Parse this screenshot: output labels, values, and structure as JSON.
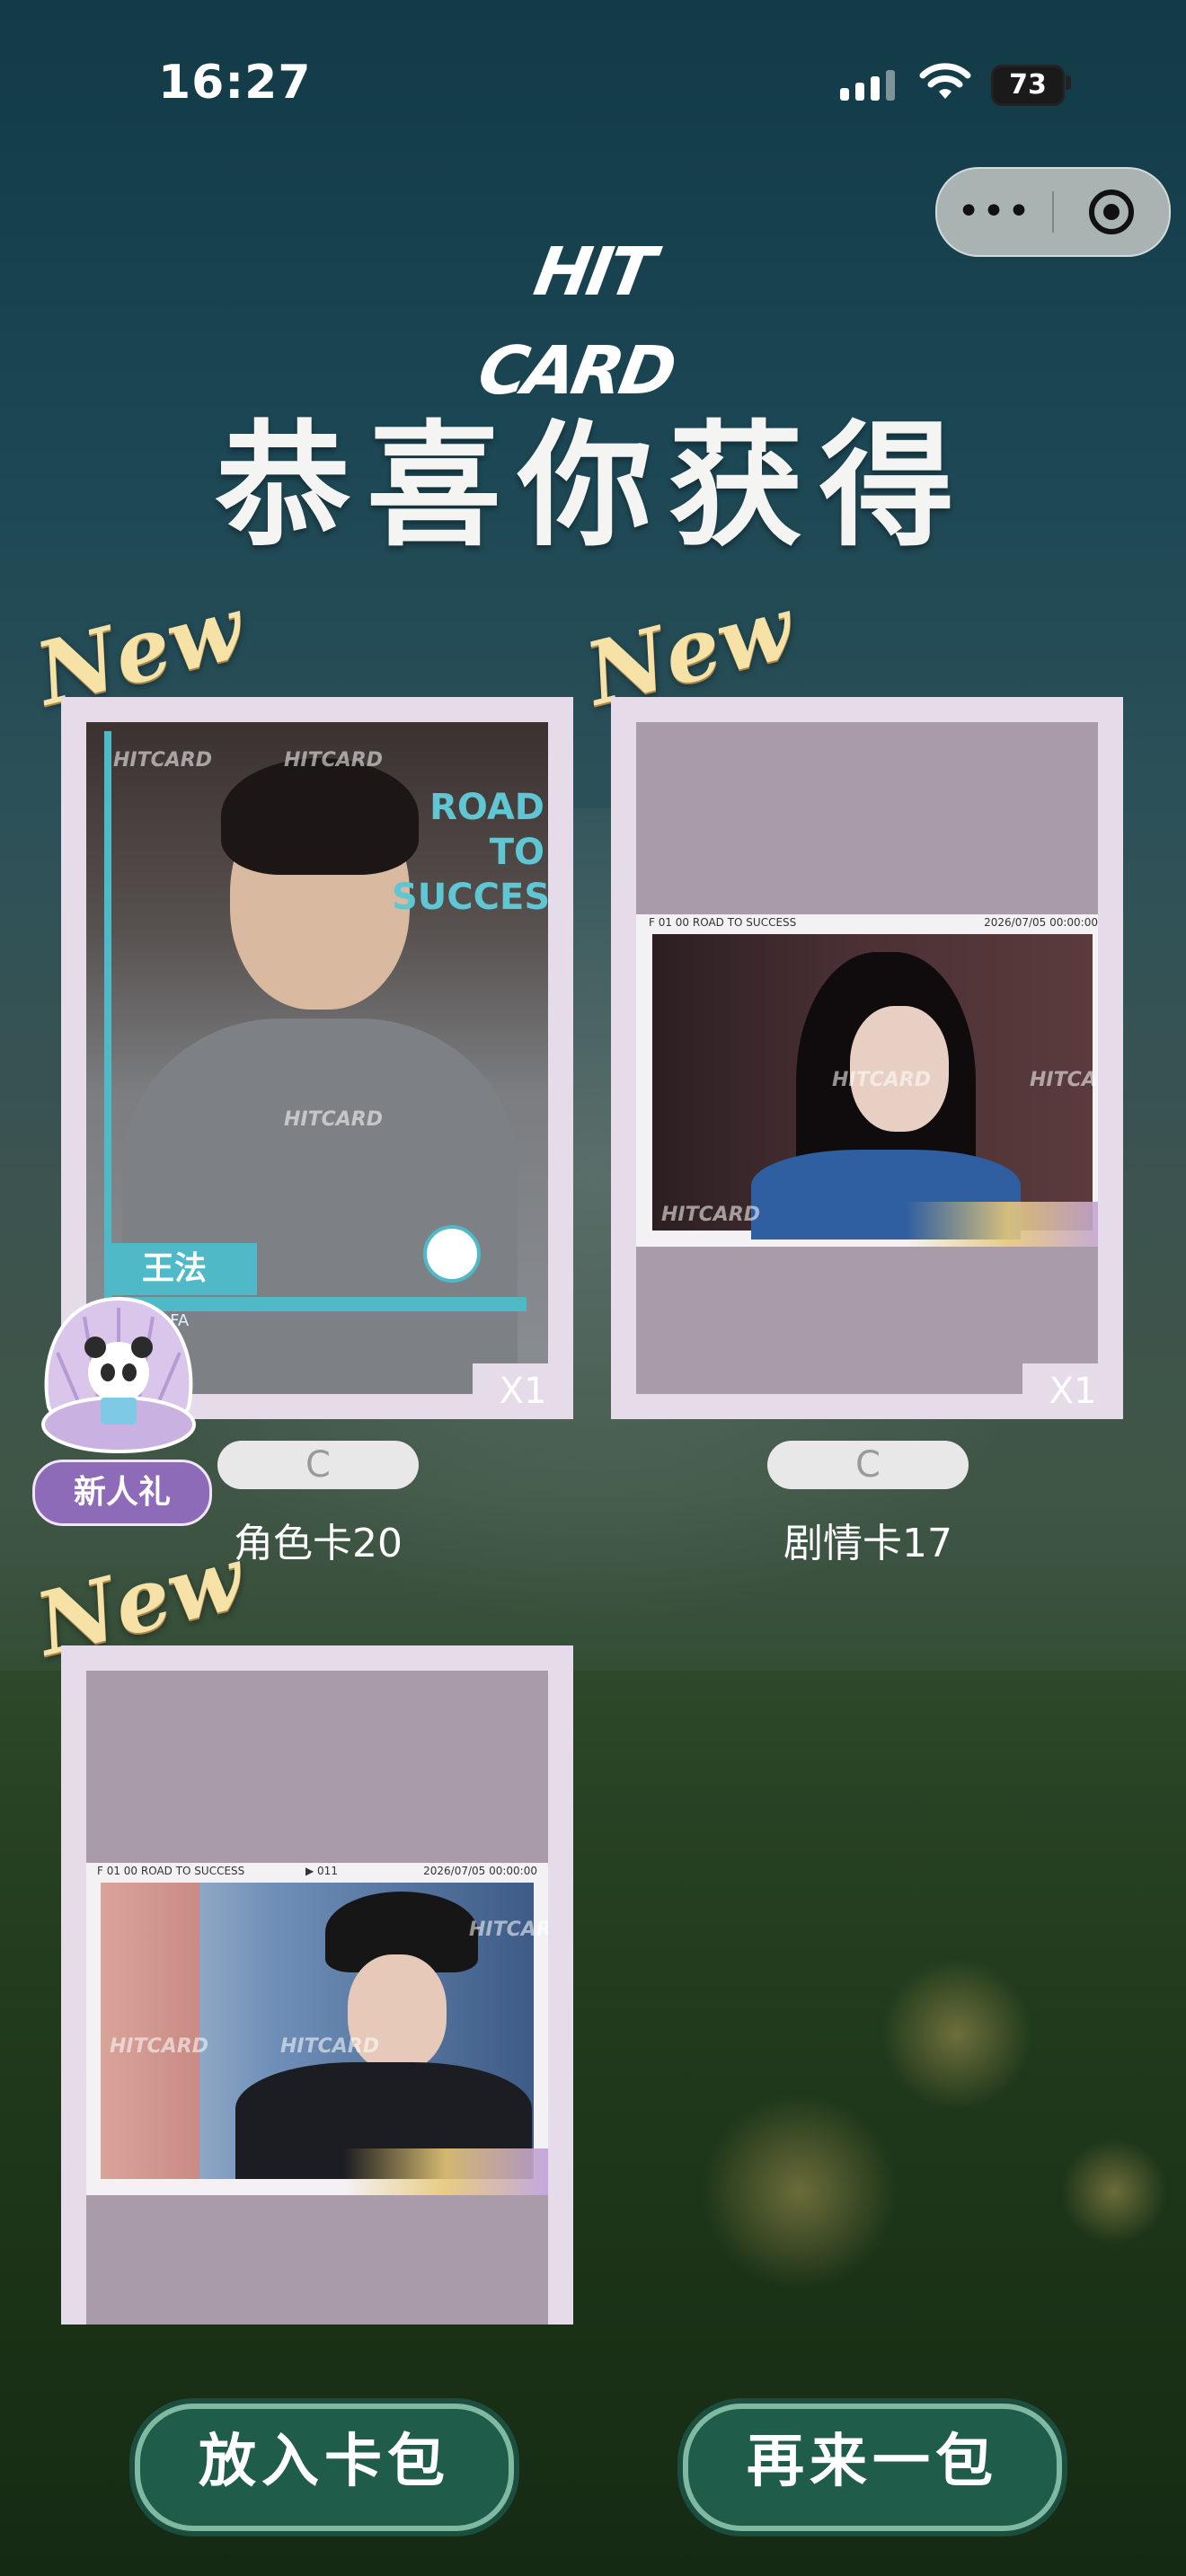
{
  "status_bar": {
    "time": "16:27",
    "battery": "73"
  },
  "capsule": {
    "more_icon": "more-dots-icon",
    "close_icon": "target-circle-icon"
  },
  "brand": {
    "logo": "HIT CARD"
  },
  "headline": "恭喜你获得",
  "new_badge": "New",
  "watermark": "HITCARD",
  "cards": [
    {
      "quantity": "X1",
      "rarity": "C",
      "name": "角色卡20",
      "overlay_title": "ROAD TO SUCCESS",
      "overlay_name": "王法",
      "overlay_sub": "NG FA"
    },
    {
      "quantity": "X1",
      "rarity": "C",
      "name": "剧情卡17",
      "overlay_header_left": "F 01 00 ROAD TO SUCCESS",
      "overlay_header_right": "2026/07/05 00:00:00"
    },
    {
      "overlay_header_left": "F 01 00 ROAD TO SUCCESS",
      "overlay_header_mid": "▶ 011",
      "overlay_header_right": "2026/07/05 00:00:00"
    }
  ],
  "newbie_gift": {
    "label": "新人礼",
    "icon": "panda-shell-icon"
  },
  "buttons": {
    "add_to_pack": "放入卡包",
    "open_another": "再来一包"
  },
  "colors": {
    "card_frame": "#e6dbe8",
    "card_inner": "#a99ba9",
    "button_fill": "#1f5c4a",
    "new_gold": "#f6e1a6"
  }
}
